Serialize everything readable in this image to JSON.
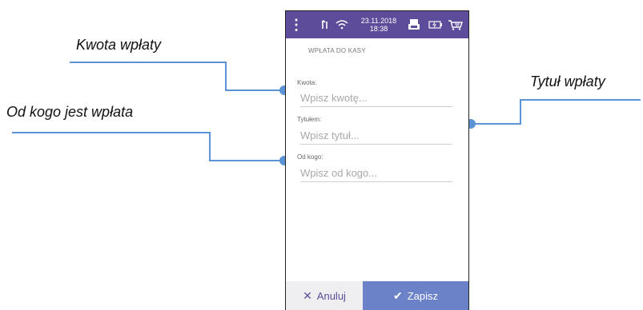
{
  "callouts": {
    "kwota": "Kwota wpłaty",
    "od_kogo": "Od kogo jest wpłata",
    "tytul": "Tytuł wpłaty"
  },
  "statusbar": {
    "date": "23.11.2018",
    "time": "18:38",
    "icons": [
      "menu-icon",
      "antenna-icon",
      "wifi-icon",
      "printer-icon",
      "battery-icon",
      "cart-icon"
    ]
  },
  "form": {
    "title": "WPŁATA DO KASY",
    "amount_label": "Kwota:",
    "amount_placeholder": "Wpisz kwotę...",
    "title_label": "Tytułem:",
    "title_placeholder": "Wpisz tytuł...",
    "from_label": "Od kogo:",
    "from_placeholder": "Wpisz od kogo..."
  },
  "buttons": {
    "cancel": "Anuluj",
    "save": "Zapisz"
  },
  "colors": {
    "statusbar": "#5d4c9a",
    "save_button": "#6b82c8",
    "callout_line": "#5a93d6"
  }
}
